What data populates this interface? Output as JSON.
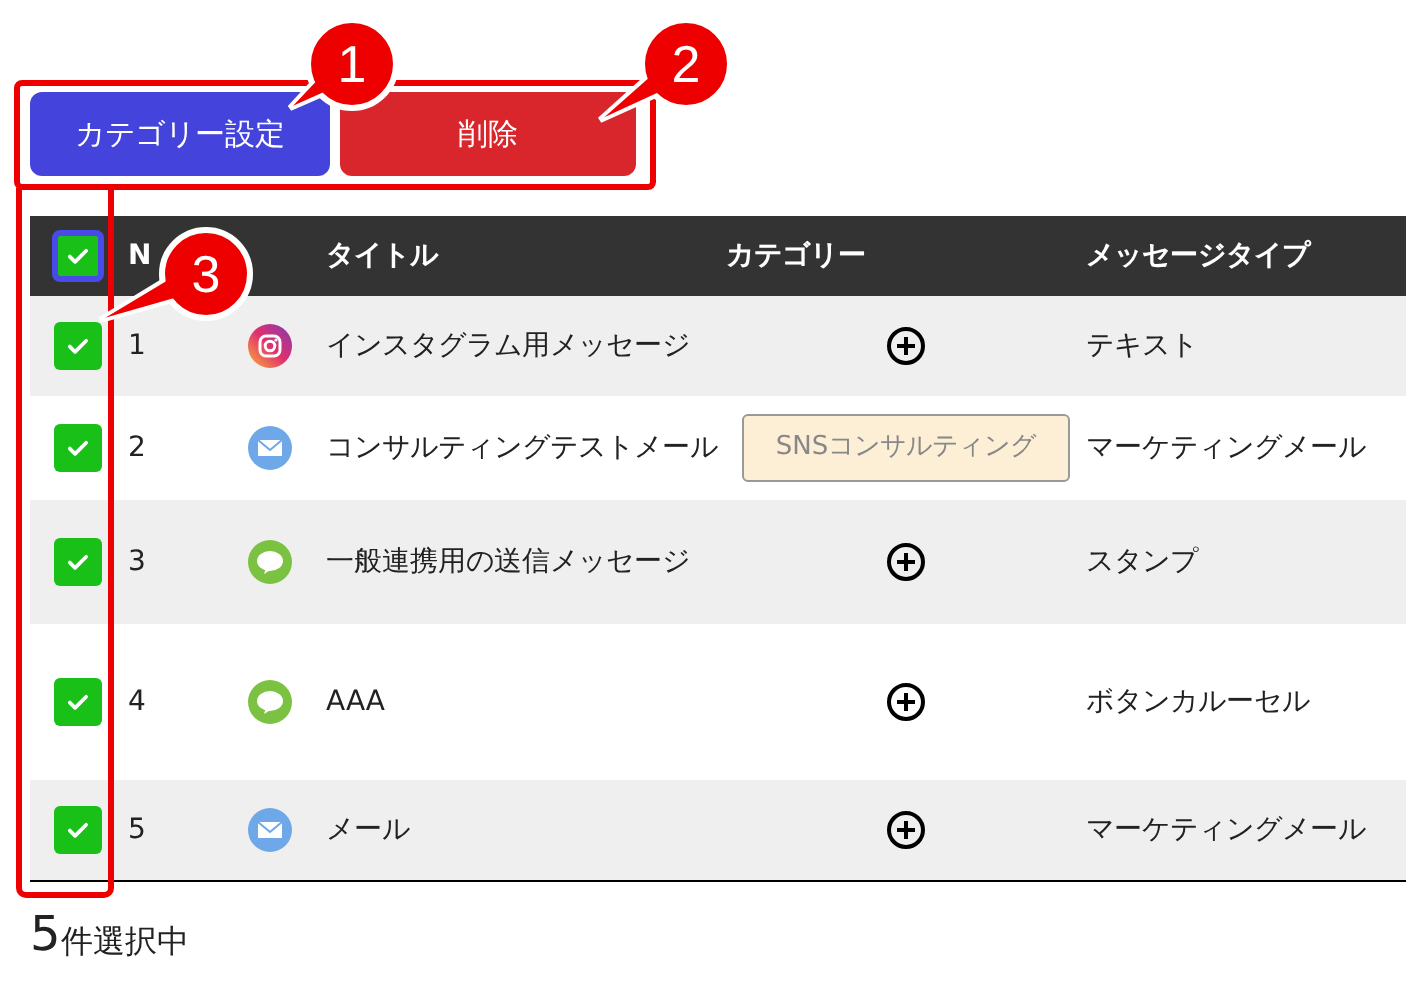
{
  "buttons": [
    {
      "label": "カテゴリー設定",
      "kind": "category"
    },
    {
      "label": "削除",
      "kind": "delete"
    }
  ],
  "table": {
    "select_all": {
      "checked": true
    },
    "columns": [
      "N",
      "タイトル",
      "カテゴリー",
      "メッセージタイプ"
    ],
    "rows": [
      {
        "checked": true,
        "no": "1",
        "kind": "instagram",
        "title": "インスタグラム用メッセージ",
        "type": "テキスト"
      },
      {
        "checked": true,
        "no": "2",
        "kind": "mail",
        "title": "コンサルティングテストメール",
        "category": "SNSコンサルティング",
        "type": "マーケティングメール"
      },
      {
        "checked": true,
        "no": "3",
        "kind": "line",
        "title": "一般連携用の送信メッセージ",
        "type": "スタンプ"
      },
      {
        "checked": true,
        "no": "4",
        "kind": "line",
        "title": "AAA",
        "type": "ボタンカルーセル"
      },
      {
        "checked": true,
        "no": "5",
        "kind": "mail",
        "title": "メール",
        "type": "マーケティングメール"
      }
    ]
  },
  "selection": {
    "count": "5",
    "suffix": "件選択中"
  },
  "annotations": [
    {
      "label": "1"
    },
    {
      "label": "2"
    },
    {
      "label": "3"
    }
  ]
}
